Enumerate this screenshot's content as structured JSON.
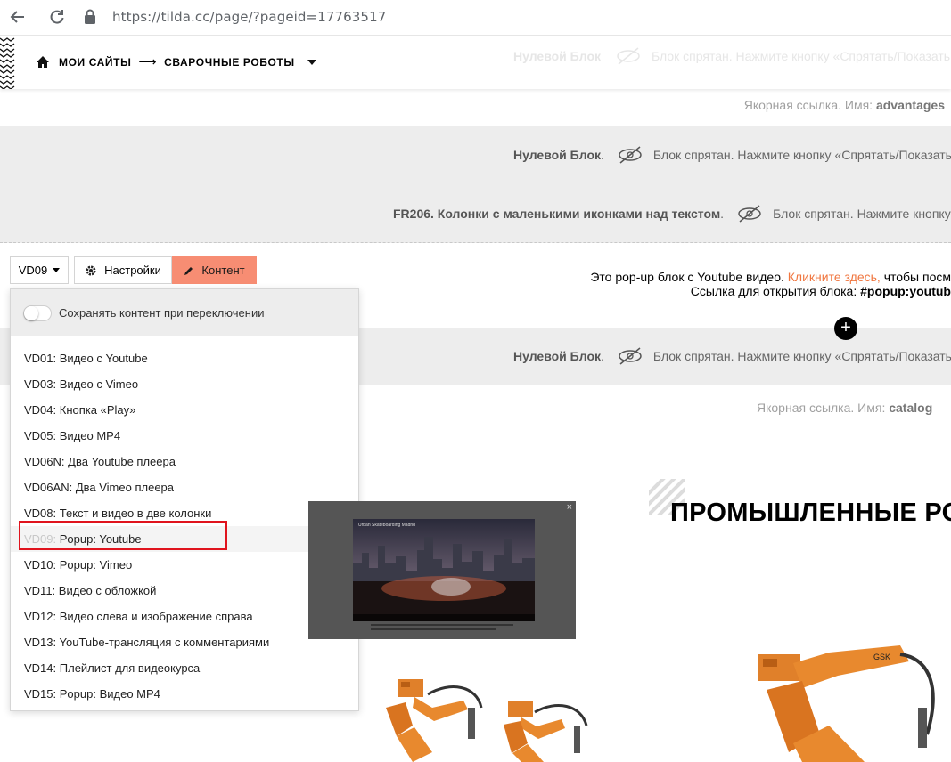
{
  "browser": {
    "url": "https://tilda.cc/page/?pageid=17763517"
  },
  "header": {
    "breadcrumb_1": "МОИ САЙТЫ",
    "arrow": "⟶",
    "breadcrumb_2": "СВАРОЧНЫЕ РОБОТЫ",
    "faded_block": "Нулевой Блок",
    "faded_hint": "Блок спрятан. Нажмите кнопку «Спрятать/Показать"
  },
  "anchors": {
    "anchor_1_prefix": "Якорная ссылка. Имя:",
    "anchor_1_name": "advantages",
    "anchor_2_prefix": "Якорная ссылка. Имя:",
    "anchor_2_name": "catalog"
  },
  "blocks": {
    "zero_block_1_name": "Нулевой Блок",
    "zero_block_1_hint": "Блок спрятан. Нажмите кнопку «Спрятать/Показать",
    "fr206_name": "FR206. Колонки с маленькими иконками над текстом",
    "fr206_hint": "Блок спрятан. Нажмите кнопку",
    "zero_block_2_name": "Нулевой Блок",
    "zero_block_2_hint": "Блок спрятан. Нажмите кнопку «Спрятать/Показать"
  },
  "toolbar": {
    "block_code": "VD09",
    "settings_label": "Настройки",
    "content_label": "Контент"
  },
  "popup_block": {
    "line1_start": "Это pop-up блок с Youtube видео.",
    "line1_link": "Кликните здесь,",
    "line1_end": "чтобы посм",
    "line2_start": "Ссылка для открытия блока:",
    "line2_code": "#popup:youtub"
  },
  "dropdown": {
    "toggle_label": "Сохранять контент при переключении",
    "items": [
      {
        "code": "VD01:",
        "label": "Видео с Youtube"
      },
      {
        "code": "VD03:",
        "label": "Видео с Vimeo"
      },
      {
        "code": "VD04:",
        "label": "Кнопка «Play»"
      },
      {
        "code": "VD05:",
        "label": "Видео MP4"
      },
      {
        "code": "VD06N:",
        "label": "Два Youtube плеера"
      },
      {
        "code": "VD06AN:",
        "label": "Два Vimeo плеера"
      },
      {
        "code": "VD08:",
        "label": "Текст и видео в две колонки"
      },
      {
        "code": "VD09:",
        "label": "Popup: Youtube"
      },
      {
        "code": "VD10:",
        "label": "Popup: Vimeo"
      },
      {
        "code": "VD11:",
        "label": "Видео с обложкой"
      },
      {
        "code": "VD12:",
        "label": "Видео слева и изображение справа"
      },
      {
        "code": "VD13:",
        "label": "YouTube-трансляция с комментариями"
      },
      {
        "code": "VD14:",
        "label": "Плейлист для видеокурса"
      },
      {
        "code": "VD15:",
        "label": "Popup: Видео MP4"
      }
    ]
  },
  "preview": {
    "close": "×",
    "video_title": "Urban Skateboarding Madrid"
  },
  "section": {
    "title": "ПРОМЫШЛЕННЫЕ РО"
  },
  "colors": {
    "accent": "#f78d73",
    "link": "#f0763f",
    "highlight": "#e0141e",
    "grey_block": "#ededed"
  }
}
